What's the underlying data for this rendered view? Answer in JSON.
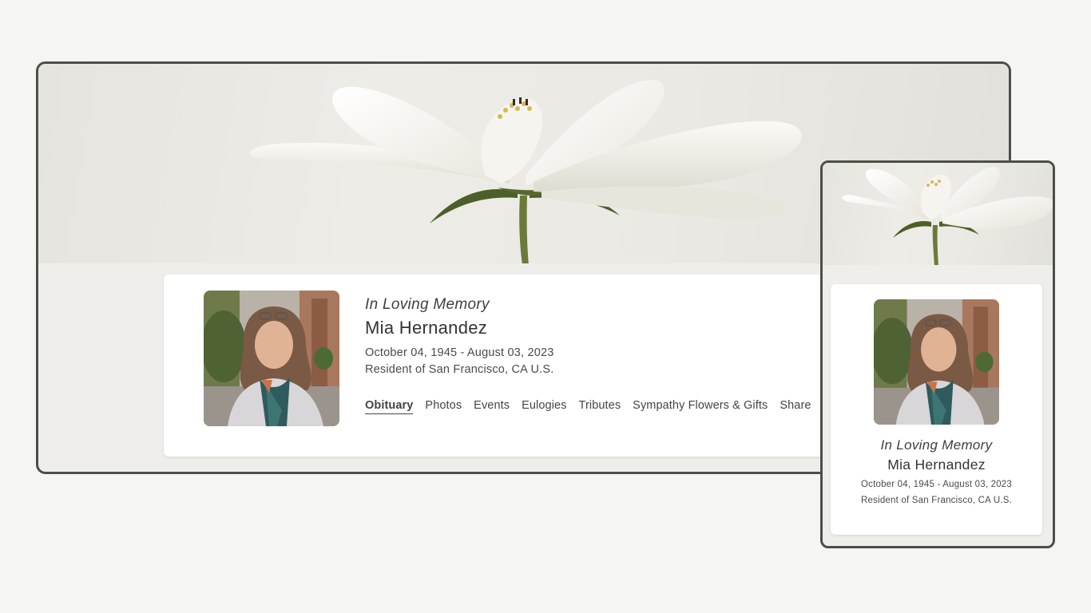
{
  "memorial": {
    "heading": "In Loving Memory",
    "name": "Mia Hernandez",
    "dates": "October 04, 1945 - August 03, 2023",
    "residence": "Resident of San Francisco, CA U.S."
  },
  "nav": {
    "items": [
      "Obituary",
      "Photos",
      "Events",
      "Eulogies",
      "Tributes",
      "Sympathy Flowers & Gifts",
      "Share"
    ],
    "active": "Obituary"
  },
  "colors": {
    "page_background": "#f5f5f4",
    "frame_border": "#4c4f47",
    "card_background": "#ffffff",
    "text": "#3b3b3b"
  }
}
